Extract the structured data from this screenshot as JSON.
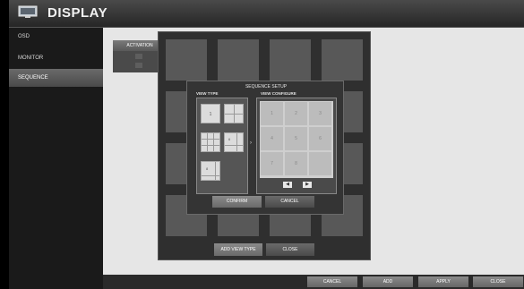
{
  "title": "DISPLAY",
  "sidebar": {
    "items": [
      {
        "label": "OSD"
      },
      {
        "label": "MONITOR"
      },
      {
        "label": "SEQUENCE"
      }
    ]
  },
  "main": {
    "activation_label": "ACTIVATION"
  },
  "sequence_panel": {
    "add_view_type_label": "ADD VIEW TYPE",
    "close_label": "CLOSE"
  },
  "dialog": {
    "title": "SEQUENCE SETUP",
    "view_type_label": "VIEW TYPE",
    "view_configure_label": "VIEW CONFIGURE",
    "view_type_single": "1",
    "view_type_four": "4",
    "view_type_six": "6",
    "view_type_eight": "8",
    "arrow": "›",
    "configure_cells": [
      "1",
      "2",
      "3",
      "4",
      "5",
      "6",
      "7",
      "8",
      ""
    ],
    "prev": "◀",
    "next": "▶",
    "confirm_label": "CONFIRM",
    "cancel_label": "CANCEL"
  },
  "bottom": {
    "cancel_label": "CANCEL",
    "add_label": "ADD",
    "apply_label": "APPLY",
    "close_label": "CLOSE"
  }
}
